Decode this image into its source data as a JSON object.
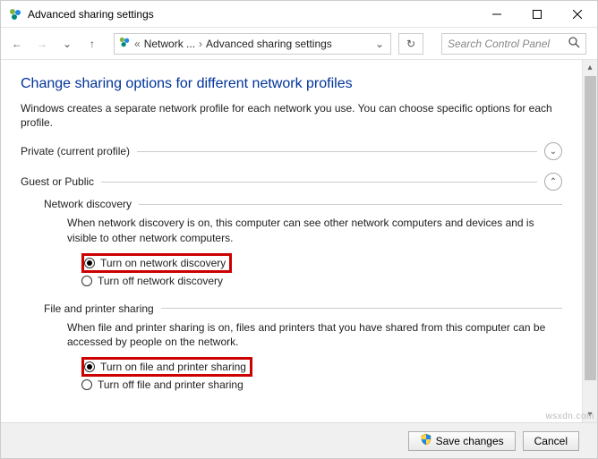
{
  "titlebar": {
    "title": "Advanced sharing settings"
  },
  "nav": {
    "crumb1": "Network ...",
    "crumb2": "Advanced sharing settings",
    "search_placeholder": "Search Control Panel"
  },
  "page": {
    "heading": "Change sharing options for different network profiles",
    "intro": "Windows creates a separate network profile for each network you use. You can choose specific options for each profile."
  },
  "profiles": {
    "private": {
      "label": "Private (current profile)"
    },
    "guest": {
      "label": "Guest or Public"
    }
  },
  "network_discovery": {
    "heading": "Network discovery",
    "desc": "When network discovery is on, this computer can see other network computers and devices and is visible to other network computers.",
    "on_label": "Turn on network discovery",
    "off_label": "Turn off network discovery"
  },
  "file_printer": {
    "heading": "File and printer sharing",
    "desc": "When file and printer sharing is on, files and printers that you have shared from this computer can be accessed by people on the network.",
    "on_label": "Turn on file and printer sharing",
    "off_label": "Turn off file and printer sharing"
  },
  "footer": {
    "save": "Save changes",
    "cancel": "Cancel"
  },
  "watermark": "wsxdn.com"
}
